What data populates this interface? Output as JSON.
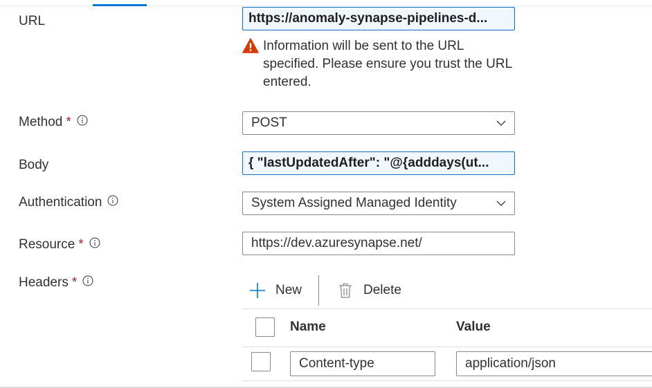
{
  "fields": {
    "url": {
      "label": "URL",
      "value": "https://anomaly-synapse-pipelines-d..."
    },
    "warning": {
      "text": "Information will be sent to the URL specified. Please ensure you trust the URL entered."
    },
    "method": {
      "label": "Method",
      "required": "*",
      "value": "POST"
    },
    "body": {
      "label": "Body",
      "value": "{ \"lastUpdatedAfter\": \"@{adddays(ut..."
    },
    "authentication": {
      "label": "Authentication",
      "value": "System Assigned Managed Identity"
    },
    "resource": {
      "label": "Resource",
      "required": "*",
      "value": "https://dev.azuresynapse.net/"
    },
    "headers": {
      "label": "Headers",
      "required": "*"
    }
  },
  "headers_table": {
    "toolbar": {
      "new_label": "New",
      "delete_label": "Delete"
    },
    "columns": {
      "name": "Name",
      "value": "Value"
    },
    "rows": [
      {
        "name": "Content-type",
        "value": "application/json"
      }
    ]
  },
  "colors": {
    "accent": "#0078d4",
    "required": "#a4262c",
    "warning": "#d83b01"
  },
  "icons": [
    "info-icon",
    "warning-icon",
    "chevron-down-icon",
    "plus-icon",
    "trash-icon"
  ]
}
